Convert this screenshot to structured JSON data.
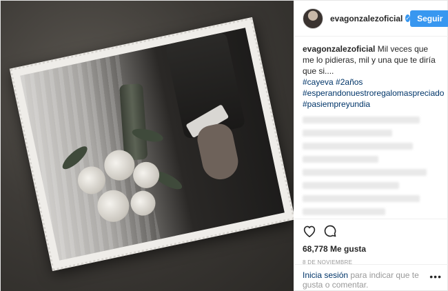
{
  "header": {
    "username": "evagonzalezoficial",
    "follow_label": "Seguir"
  },
  "caption": {
    "username": "evagonzalezoficial",
    "text": "Mil veces que me lo pidieras, mil y una que te diría que si....",
    "hashtags_line1": [
      "#cayeva",
      "#2años"
    ],
    "hashtags": [
      "#esperandonuestroregalomaspreciado",
      "#pasiempreyundia"
    ]
  },
  "actions": {
    "like_icon": "heart-outline-icon",
    "comment_icon": "comment-bubble-icon",
    "likes_label": "68,778 Me gusta",
    "date": "8 DE NOVIEMBRE"
  },
  "login": {
    "link_label": "Inicia sesión",
    "rest_text": " para indicar que te gusta o comentar."
  },
  "more_icon": "ellipsis-icon",
  "colors": {
    "accent": "#3897f0",
    "link": "#003569"
  }
}
